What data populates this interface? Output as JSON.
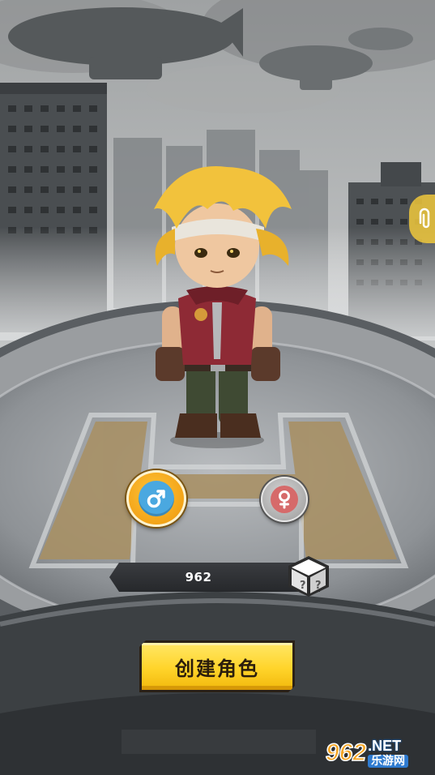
{
  "character": {
    "name": "962"
  },
  "gender": {
    "male_symbol": "♂",
    "female_symbol": "♀",
    "selected": "male"
  },
  "actions": {
    "create_label": "创建角色"
  },
  "watermark": {
    "number": "962",
    "domain": ".NET",
    "site": "乐游网"
  },
  "colors": {
    "accent_yellow": "#ffd42a",
    "male_blue": "#4aa8e0",
    "female_red": "#d66a6a"
  }
}
